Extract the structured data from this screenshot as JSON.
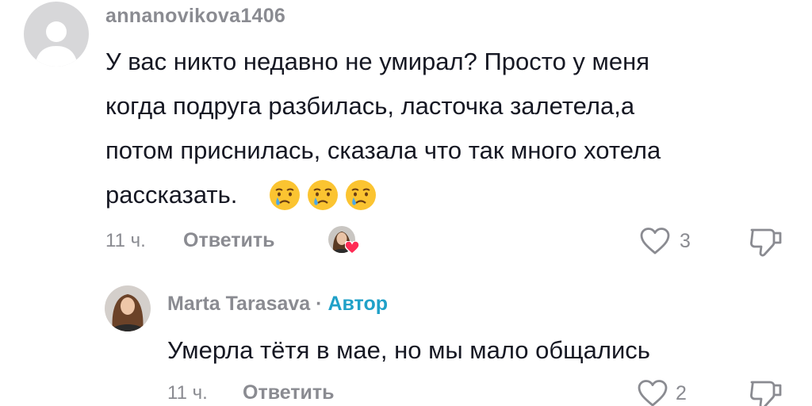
{
  "comments": [
    {
      "username": "annanovikova1406",
      "avatar_icon": "default-avatar-icon",
      "text_lines": [
        "У вас никто недавно не умирал? Просто у меня",
        "когда подруга разбилась, ласточка залетела,а",
        "потом приснилась, сказала что так много хотела",
        "рассказать."
      ],
      "emoji_icons": [
        "crying-face-icon",
        "crying-face-icon",
        "crying-face-icon"
      ],
      "time": "11 ч.",
      "reply_label": "Ответить",
      "liked_by_creator_icon": "creator-liked-avatar-icon",
      "likes": "3",
      "like_icon": "heart-outline-icon",
      "dislike_icon": "thumbs-down-icon"
    },
    {
      "username": "Marta Tarasava",
      "separator": "·",
      "author_label": "Автор",
      "avatar_icon": "user-avatar-icon",
      "text": "Умерла тётя в мае, но мы мало общались",
      "time": "11 ч.",
      "reply_label": "Ответить",
      "likes": "2",
      "like_icon": "heart-outline-icon",
      "dislike_icon": "thumbs-down-icon"
    }
  ],
  "colors": {
    "text": "#161823",
    "muted": "#8a8b91",
    "author": "#20a1c8",
    "heart": "#fe2c55"
  }
}
